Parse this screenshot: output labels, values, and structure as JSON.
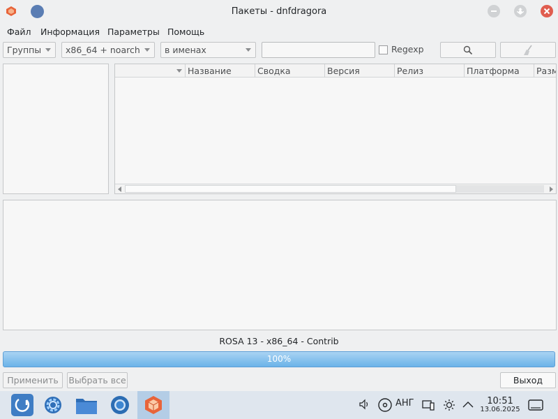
{
  "window": {
    "title": "Пакеты - dnfdragora"
  },
  "menubar": {
    "items": [
      {
        "label": "Файл"
      },
      {
        "label": "Информация"
      },
      {
        "label": "Параметры"
      },
      {
        "label": "Помощь"
      }
    ]
  },
  "toolbar": {
    "view_combo": "Группы",
    "arch_combo": "x86_64 + noarch",
    "search_field_combo": "в именах",
    "search_value": "",
    "regexp_label": "Regexp",
    "regexp_checked": false
  },
  "table": {
    "columns": [
      "",
      "Название",
      "Сводка",
      "Версия",
      "Релиз",
      "Платформа",
      "Разм"
    ],
    "rows": []
  },
  "status": {
    "repo_info": "ROSA 13 - x86_64 - Contrib",
    "progress_label": "100%",
    "progress_value": 100
  },
  "buttons": {
    "apply": "Применить",
    "select_all": "Выбрать все",
    "exit": "Выход"
  },
  "taskbar": {
    "keyboard_layout": "АНГ",
    "time": "10:51",
    "date": "13.06.2025"
  },
  "colors": {
    "accent": "#6bb3e8",
    "close_button": "#e05d4f",
    "taskbar_bg": "#dfe6ee"
  }
}
